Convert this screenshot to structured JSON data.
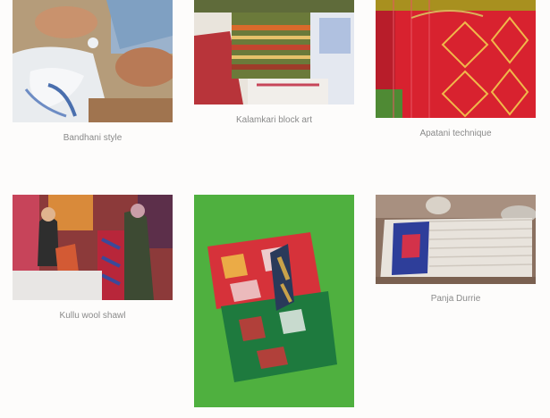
{
  "gallery": {
    "items": [
      {
        "caption": "Bandhani style",
        "image": "hands-tying-bandhani-fabric"
      },
      {
        "caption": "Kalamkari block art",
        "image": "stacked-block-printed-textiles"
      },
      {
        "caption": "Apatani technique",
        "image": "red-loom-woven-cloth"
      },
      {
        "caption": "Kullu wool shawl",
        "image": "shawl-shop-interior"
      },
      {
        "caption": "",
        "image": "red-green-ikat-fabrics-on-grass"
      },
      {
        "caption": "Panja Durrie",
        "image": "durrie-rug-on-loom"
      }
    ]
  }
}
